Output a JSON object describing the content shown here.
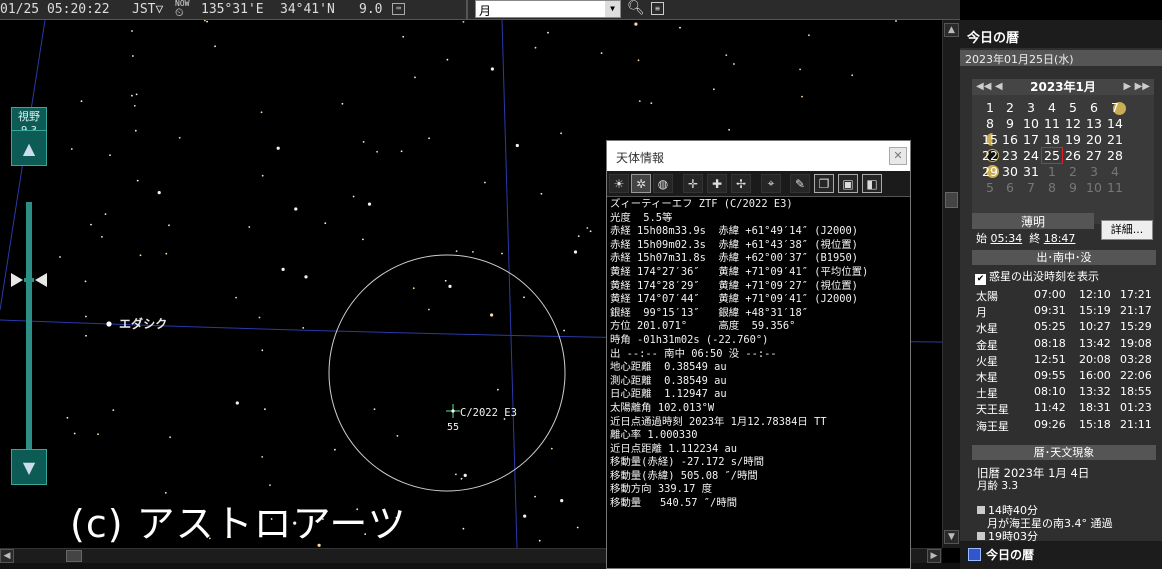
{
  "toolbar": {
    "datetime": "01/25 05:20:22",
    "timezone": "JST▽",
    "now_icon_label": "NOW",
    "longitude": "135°31'E",
    "latitude": "34°41'N",
    "limit_mag": "9.0",
    "search_value": "月"
  },
  "fov": {
    "label": "視野",
    "value": "9.3"
  },
  "sky": {
    "star_label_edasich": "エダシク",
    "comet_label": "C/2022 E3",
    "comet_mag": "55"
  },
  "copyright": "(c) アストロアーツ",
  "info_panel": {
    "title": "天体情報",
    "lines": [
      "ズィーティーエフ ZTF (C/2022 E3)",
      "光度  5.5等",
      "赤経 15h08m33.9s  赤緯 +61°49′14″ (J2000)",
      "赤経 15h09m02.3s  赤緯 +61°43′38″ (視位置)",
      "赤経 15h07m31.8s  赤緯 +62°00′37″ (B1950)",
      "黄経 174°27′36″   黄緯 +71°09′41″ (平均位置)",
      "黄経 174°28′29″   黄緯 +71°09′27″ (視位置)",
      "黄経 174°07′44″   黄緯 +71°09′41″ (J2000)",
      "銀経  99°15′13″   銀緯 +48°31′18″",
      "方位 201.071°     高度  59.356°",
      "時角 -01h31m02s (-22.760°)",
      "出 --:-- 南中 06:50 没 --:--",
      "地心距離  0.38549 au",
      "測心距離  0.38549 au",
      "日心距離  1.12947 au",
      "太陽離角 102.013°W",
      "近日点通過時刻 2023年 1月12.78384日 TT",
      "離心率 1.000330",
      "近日点距離 1.112234 au",
      "移動量(赤経) -27.172 s/時間",
      "移動量(赤緯) 505.08 ″/時間",
      "移動方向 339.17 度",
      "移動量   540.57 ″/時間"
    ]
  },
  "right_panel": {
    "header": "今日の暦",
    "date": "2023年01月25日(水)",
    "month_label": "2023年1月",
    "nav_prev": "◀◀ ◀",
    "nav_next": "▶ ▶▶",
    "calendar_rows": [
      [
        "1",
        "2",
        "3",
        "4",
        "5",
        "6",
        "7"
      ],
      [
        "8",
        "9",
        "10",
        "11",
        "12",
        "13",
        "14"
      ],
      [
        "15",
        "16",
        "17",
        "18",
        "19",
        "20",
        "21"
      ],
      [
        "22",
        "23",
        "24",
        "25",
        "26",
        "27",
        "28"
      ],
      [
        "29",
        "30",
        "31",
        "1",
        "2",
        "3",
        "4"
      ],
      [
        "5",
        "6",
        "7",
        "8",
        "9",
        "10",
        "11"
      ]
    ],
    "today": "25",
    "twilight_title": "薄明",
    "twilight_start_label": "始",
    "twilight_start": "05:34",
    "twilight_end_label": "終",
    "twilight_end": "18:47",
    "detail_button": "詳細...",
    "rise_section": "出･南中･没",
    "planet_checkbox": "惑星の出没時刻を表示",
    "planets": [
      {
        "name": "太陽",
        "rise": "07:00",
        "transit": "12:10",
        "set": "17:21"
      },
      {
        "name": "月",
        "rise": "09:31",
        "transit": "15:19",
        "set": "21:17"
      },
      {
        "name": "水星",
        "rise": "05:25",
        "transit": "10:27",
        "set": "15:29"
      },
      {
        "name": "金星",
        "rise": "08:18",
        "transit": "13:42",
        "set": "19:08"
      },
      {
        "name": "火星",
        "rise": "12:51",
        "transit": "20:08",
        "set": "03:28"
      },
      {
        "name": "木星",
        "rise": "09:55",
        "transit": "16:00",
        "set": "22:06"
      },
      {
        "name": "土星",
        "rise": "08:10",
        "transit": "13:32",
        "set": "18:55"
      },
      {
        "name": "天王星",
        "rise": "11:42",
        "transit": "18:31",
        "set": "01:23"
      },
      {
        "name": "海王星",
        "rise": "09:26",
        "transit": "15:18",
        "set": "21:11"
      }
    ],
    "calendar_section": "暦･天文現象",
    "lunar_date": "旧暦 2023年 1月 4日",
    "moon_age": "月齢 3.3",
    "event1_time": "14時40分",
    "event1_text": "月が海王星の南3.4° 通過",
    "event2_time": "19時03分",
    "footer": "今日の暦"
  },
  "colors": {
    "sky": "#000000",
    "zoom_panel": "#0d5b55",
    "moon_phase": "#c9ad54",
    "today_outline": "#dd2222"
  }
}
